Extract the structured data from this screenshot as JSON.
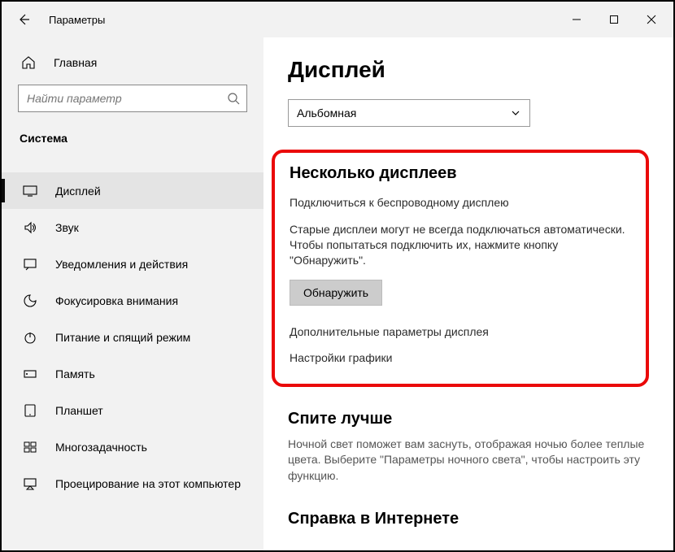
{
  "window": {
    "title": "Параметры"
  },
  "sidebar": {
    "home_label": "Главная",
    "search_placeholder": "Найти параметр",
    "category": "Система",
    "items": [
      {
        "label": "Дисплей"
      },
      {
        "label": "Звук"
      },
      {
        "label": "Уведомления и действия"
      },
      {
        "label": "Фокусировка внимания"
      },
      {
        "label": "Питание и спящий режим"
      },
      {
        "label": "Память"
      },
      {
        "label": "Планшет"
      },
      {
        "label": "Многозадачность"
      },
      {
        "label": "Проецирование на этот компьютер"
      }
    ]
  },
  "main": {
    "heading": "Дисплей",
    "orientation_value": "Альбомная",
    "multi": {
      "heading": "Несколько дисплеев",
      "connect_link": "Подключиться к беспроводному дисплею",
      "detect_desc": "Старые дисплеи могут не всегда подключаться автоматически. Чтобы попытаться подключить их, нажмите кнопку \"Обнаружить\".",
      "detect_btn": "Обнаружить",
      "advanced_link": "Дополнительные параметры дисплея",
      "graphics_link": "Настройки графики"
    },
    "sleep": {
      "heading": "Спите лучше",
      "desc": "Ночной свет поможет вам заснуть, отображая ночью более теплые цвета. Выберите \"Параметры ночного света\", чтобы настроить эту функцию."
    },
    "help": {
      "heading": "Справка в Интернете"
    }
  }
}
